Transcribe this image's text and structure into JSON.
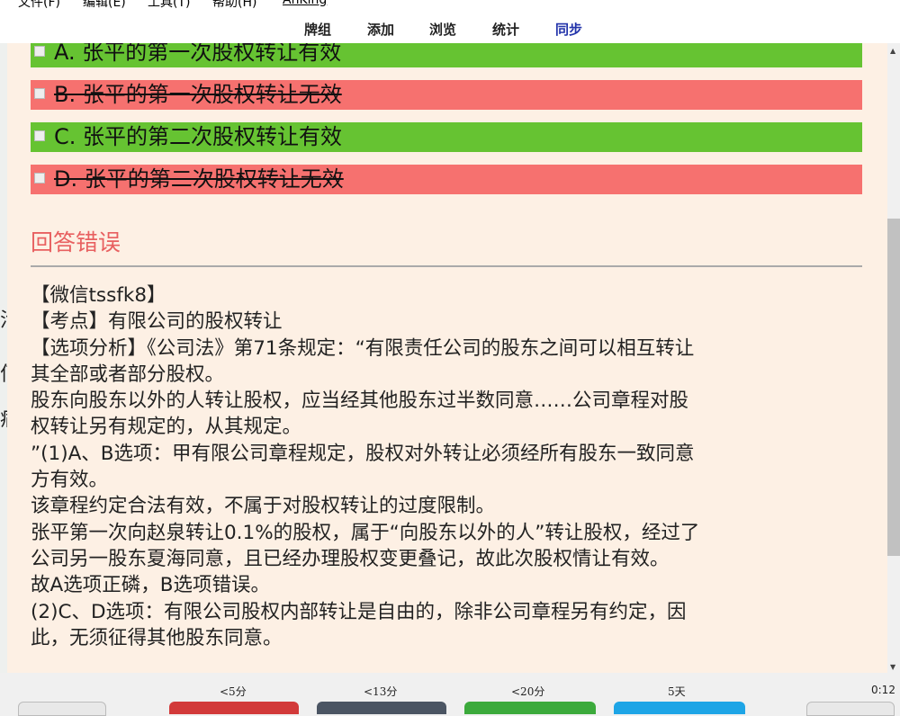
{
  "menu": [
    "文件(F)",
    "编辑(E)",
    "工具(T)",
    "帮助(H)",
    "AnKing"
  ],
  "toolbar": {
    "decks": "牌组",
    "add": "添加",
    "browse": "浏览",
    "stats": "统计",
    "sync": "同步"
  },
  "left_sliver_chars": [
    "活",
    "何",
    "病"
  ],
  "options": [
    {
      "text": "A. 张平的第一次股权转让有效",
      "status": "correct"
    },
    {
      "text": "B. 张平的第一次股权转让无效",
      "status": "wrong"
    },
    {
      "text": "C. 张平的第二次股权转让有效",
      "status": "correct"
    },
    {
      "text": "D. 张平的第二次股权转让无效",
      "status": "wrong"
    }
  ],
  "result": "回答错误",
  "explanation": [
    "【微信tssfk8】",
    "【考点】有限公司的股权转让",
    "【选项分析】《公司法》第71条规定：“有限责任公司的股东之间可以相互转让",
    "其全部或者部分股权。",
    "股东向股东以外的人转让股权，应当经其他股东过半数同意……公司章程对股",
    "权转让另有规定的，从其规定。",
    "”(1)A、B选项：甲有限公司章程规定，股权对外转让必须经所有股东一致同意",
    "方有效。",
    "该章程约定合法有效，不属于对股权转让的过度限制。",
    "张平第一次向赵泉转让0.1%的股权，属于“向股东以外的人”转让股权，经过了",
    "公司另一股东夏海同意，且已经办理股权变更叠记，故此次股权情让有效。",
    "故A选项正磷，B选项错误。",
    "(2)C、D选项：有限公司股权内部转让是自由的，除非公司章程另有约定，因",
    "此，无须征得其他股东同意。"
  ],
  "answer_bar": {
    "again_interval": "<5分",
    "hard_interval": "<13分",
    "good_interval": "<20分",
    "easy_interval": "5天",
    "timer": "0:12"
  },
  "colors": {
    "correct": "#66c332",
    "wrong": "#f6716f",
    "card_bg": "#fdf0e4",
    "again": "#d23a3a",
    "hard": "#4b5563",
    "good": "#3caa3c",
    "easy": "#1ea5e6"
  }
}
